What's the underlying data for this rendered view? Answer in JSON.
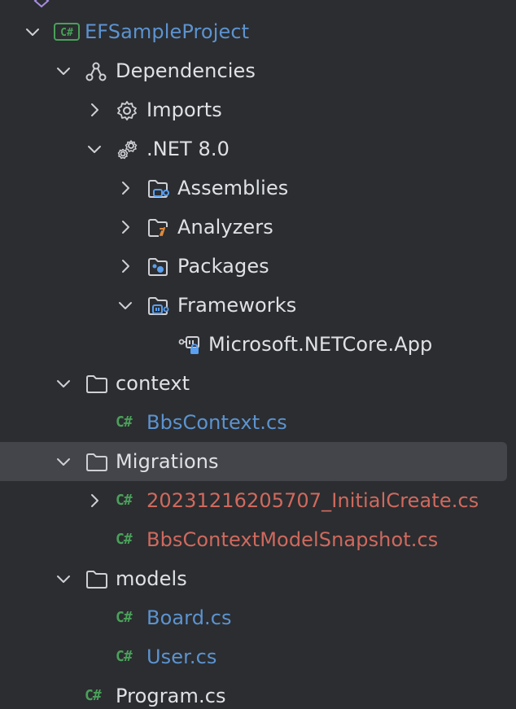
{
  "colors": {
    "background": "#2b2d30",
    "selection": "#43454a",
    "text": "#dfe1e5",
    "vcs_added_blue": "#5c93d0",
    "vcs_untracked_red": "#d0695e",
    "csharp_green": "#4aa05a",
    "icon_blue": "#5a9ff0",
    "icon_gray": "#ced0d6"
  },
  "tree": {
    "project": {
      "label": "EFSampleProject",
      "icon": "csharp-project-icon",
      "expanded": true
    },
    "dependencies": {
      "label": "Dependencies",
      "icon": "dependencies-icon",
      "expanded": true
    },
    "imports": {
      "label": "Imports",
      "icon": "gear-icon",
      "expanded": false
    },
    "net": {
      "label": ".NET 8.0",
      "icon": "gears-icon",
      "expanded": true
    },
    "assemblies": {
      "label": "Assemblies",
      "icon": "folder-assemblies-icon",
      "expanded": false
    },
    "analyzers": {
      "label": "Analyzers",
      "icon": "folder-analyzers-icon",
      "expanded": false
    },
    "packages": {
      "label": "Packages",
      "icon": "folder-packages-icon",
      "expanded": false
    },
    "frameworks": {
      "label": "Frameworks",
      "icon": "folder-frameworks-icon",
      "expanded": true
    },
    "netcore_app": {
      "label": "Microsoft.NETCore.App",
      "icon": "framework-reference-icon"
    },
    "context_folder": {
      "label": "context",
      "icon": "folder-icon",
      "expanded": true
    },
    "bbs_context": {
      "label": "BbsContext.cs",
      "icon": "csharp-file-icon",
      "badge": "C#"
    },
    "migrations_folder": {
      "label": "Migrations",
      "icon": "folder-icon",
      "expanded": true,
      "selected": true
    },
    "initial_create": {
      "label": "20231216205707_InitialCreate.cs",
      "icon": "csharp-file-icon",
      "badge": "C#",
      "expanded": false
    },
    "snapshot": {
      "label": "BbsContextModelSnapshot.cs",
      "icon": "csharp-file-icon",
      "badge": "C#"
    },
    "models_folder": {
      "label": "models",
      "icon": "folder-icon",
      "expanded": true
    },
    "board": {
      "label": "Board.cs",
      "icon": "csharp-file-icon",
      "badge": "C#"
    },
    "user": {
      "label": "User.cs",
      "icon": "csharp-file-icon",
      "badge": "C#"
    },
    "program": {
      "label": "Program.cs",
      "icon": "csharp-file-icon",
      "badge": "C#"
    }
  }
}
